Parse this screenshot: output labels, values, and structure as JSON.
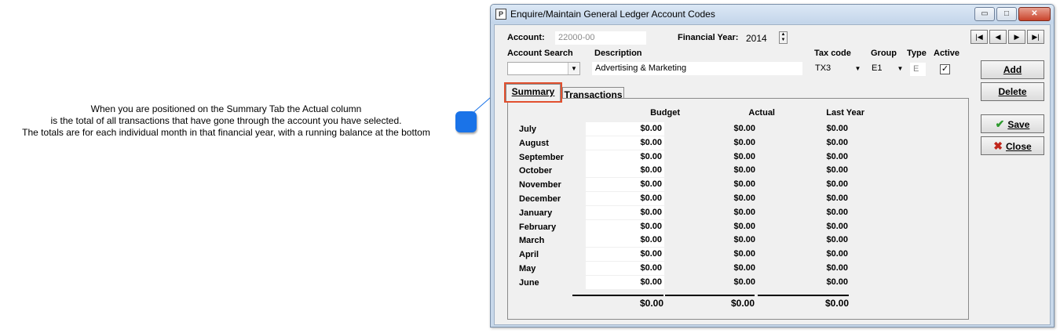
{
  "callout": {
    "lines": [
      "When you are positioned on the Summary Tab the Actual column",
      "is the total of all transactions that have gone through the account you have selected.",
      "The totals are for each individual month in that financial year, with a running balance at the bottom"
    ]
  },
  "window": {
    "title": "Enquire/Maintain General Ledger Account Codes",
    "app_icon_glyph": "P",
    "min_glyph": "▭",
    "max_glyph": "□",
    "close_glyph": "✕"
  },
  "form": {
    "account_label": "Account:",
    "account_value": "22000-00",
    "financial_year_label": "Financial Year:",
    "financial_year_value": "2014",
    "account_search_label": "Account Search",
    "account_search_value": "",
    "description_label": "Description",
    "description_value": "Advertising & Marketing",
    "tax_code_label": "Tax code",
    "tax_code_value": "TX3",
    "group_label": "Group",
    "group_value": "E1",
    "type_label": "Type",
    "type_value": "E",
    "active_label": "Active",
    "active_checked": "✓"
  },
  "nav": {
    "first": "|◀",
    "prev": "◀",
    "next": "▶",
    "last": "▶|"
  },
  "buttons": {
    "add": "Add",
    "delete": "Delete",
    "save": "Save",
    "close": "Close"
  },
  "tabs": {
    "summary": "Summary",
    "transactions": "Transactions"
  },
  "summary": {
    "headers": {
      "budget": "Budget",
      "actual": "Actual",
      "last_year": "Last Year"
    },
    "rows": [
      {
        "month": "July",
        "budget": "$0.00",
        "actual": "$0.00",
        "last_year": "$0.00"
      },
      {
        "month": "August",
        "budget": "$0.00",
        "actual": "$0.00",
        "last_year": "$0.00"
      },
      {
        "month": "September",
        "budget": "$0.00",
        "actual": "$0.00",
        "last_year": "$0.00"
      },
      {
        "month": "October",
        "budget": "$0.00",
        "actual": "$0.00",
        "last_year": "$0.00"
      },
      {
        "month": "November",
        "budget": "$0.00",
        "actual": "$0.00",
        "last_year": "$0.00"
      },
      {
        "month": "December",
        "budget": "$0.00",
        "actual": "$0.00",
        "last_year": "$0.00"
      },
      {
        "month": "January",
        "budget": "$0.00",
        "actual": "$0.00",
        "last_year": "$0.00"
      },
      {
        "month": "February",
        "budget": "$0.00",
        "actual": "$0.00",
        "last_year": "$0.00"
      },
      {
        "month": "March",
        "budget": "$0.00",
        "actual": "$0.00",
        "last_year": "$0.00"
      },
      {
        "month": "April",
        "budget": "$0.00",
        "actual": "$0.00",
        "last_year": "$0.00"
      },
      {
        "month": "May",
        "budget": "$0.00",
        "actual": "$0.00",
        "last_year": "$0.00"
      },
      {
        "month": "June",
        "budget": "$0.00",
        "actual": "$0.00",
        "last_year": "$0.00"
      }
    ],
    "totals": {
      "budget": "$0.00",
      "actual": "$0.00",
      "last_year": "$0.00"
    }
  },
  "colors": {
    "callout_bubble": "#1a73e8",
    "tab_highlight": "#e2502f",
    "save_icon": "#2e9a2e",
    "close_icon": "#c0261b"
  }
}
